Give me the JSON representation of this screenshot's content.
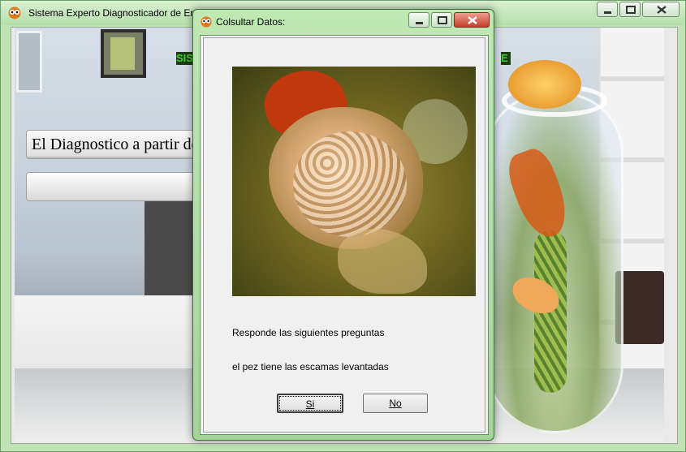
{
  "main_window": {
    "title": "Sistema Experto Diagnosticador de Enfermedades del Goldfish",
    "diagnosis_label": "El Diagnostico a partir de los sintomas es:",
    "result_value": "",
    "heading_left": "SIS",
    "heading_right": "E"
  },
  "dialog": {
    "title": "Colsultar Datos:",
    "intro": "Responde las siguientes preguntas",
    "question": "el pez tiene las escamas levantadas",
    "yes_label": "Si",
    "no_label": "No"
  },
  "colors": {
    "titlebar_green": "#b6dfac",
    "dialog_bg": "#f0f0f0",
    "heading_green": "#3bd12b"
  },
  "icons": [
    "owl-app-icon",
    "minimize-icon",
    "maximize-icon",
    "close-icon"
  ]
}
